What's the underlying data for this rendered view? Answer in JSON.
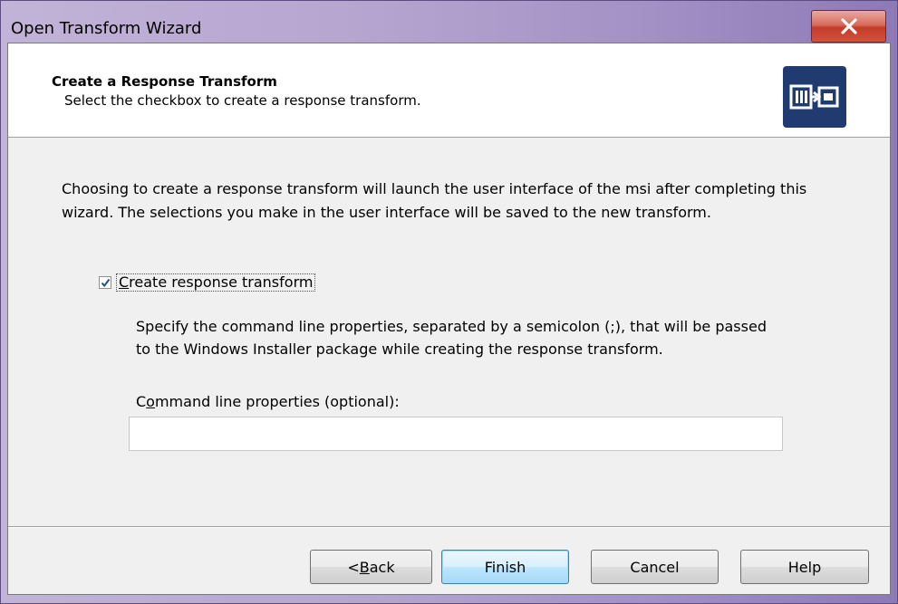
{
  "window": {
    "title": "Open Transform Wizard"
  },
  "header": {
    "title": "Create a Response Transform",
    "subtitle": "Select the checkbox to create a response transform."
  },
  "body": {
    "description_line1": "Choosing to create a response transform will launch the user interface of the msi after completing this",
    "description_line2": "wizard. The selections you make in the user interface will be saved to the new transform.",
    "checkbox": {
      "checked": true,
      "mnemonic": "C",
      "label_rest": "reate response transform"
    },
    "spec_line1": "Specify the command line properties, separated by a semicolon (;), that will be passed",
    "spec_line2": "to the Windows Installer package while creating the response transform.",
    "cmd_label_pre": "C",
    "cmd_label_mnemonic": "o",
    "cmd_label_rest": "mmand line properties (optional):",
    "cmd_value": ""
  },
  "buttons": {
    "back_prefix": "< ",
    "back_mnemonic": "B",
    "back_rest": "ack",
    "finish": "Finish",
    "cancel": "Cancel",
    "help": "Help"
  },
  "colors": {
    "header_icon_bg": "#1f3b70",
    "close_button": "#c43c28"
  }
}
